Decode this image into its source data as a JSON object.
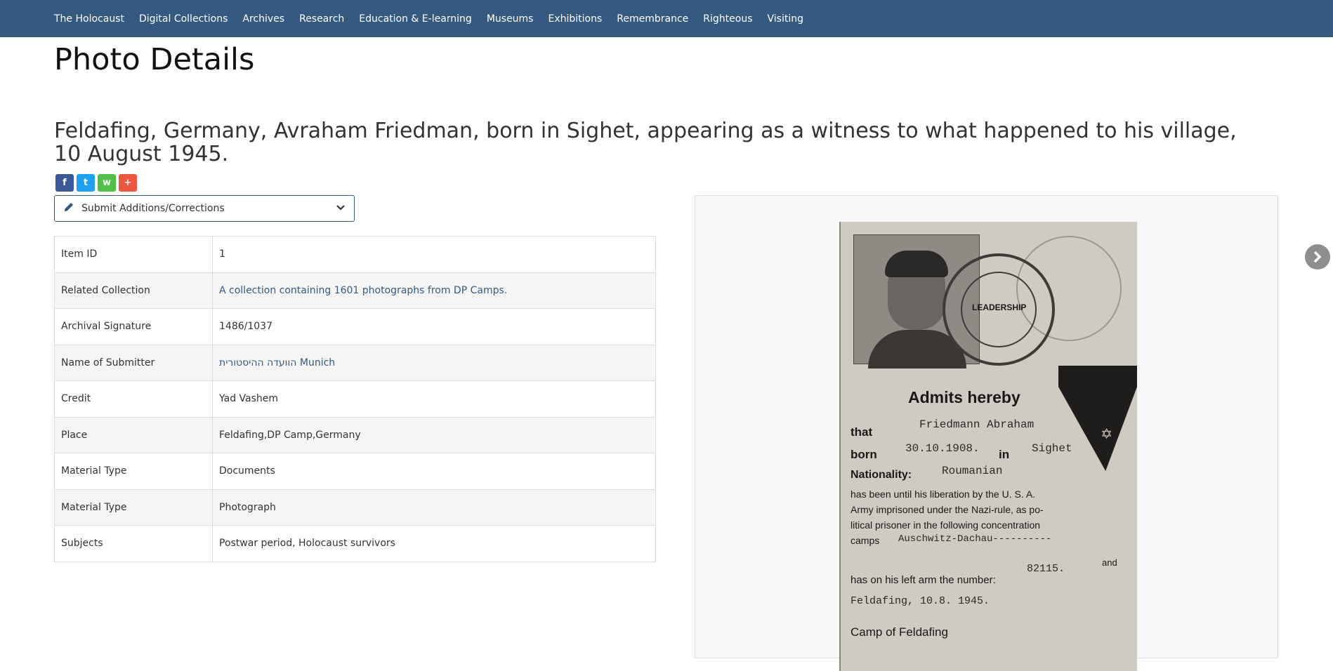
{
  "nav": {
    "items": [
      "The Holocaust",
      "Digital Collections",
      "Archives",
      "Research",
      "Education & E-learning",
      "Museums",
      "Exhibitions",
      "Remembrance",
      "Righteous",
      "Visiting"
    ]
  },
  "page": {
    "title": "Photo Details",
    "photo_title": "Feldafing, Germany, Avraham Friedman, born in Sighet, appearing as a witness to what happened to his village, 10 August 1945."
  },
  "share": {
    "facebook": "f",
    "twitter": "t",
    "whatsapp": "w",
    "more": "+"
  },
  "submit": {
    "label": "Submit Additions/Corrections"
  },
  "details": [
    {
      "key": "Item ID",
      "value": "1"
    },
    {
      "key": "Related Collection",
      "value": "A collection containing 1601 photographs from DP Camps."
    },
    {
      "key": "Archival Signature",
      "value": "1486/1037"
    },
    {
      "key": "Name of Submitter",
      "value": "הוועדה ההיסטורית Munich"
    },
    {
      "key": "Credit",
      "value": "Yad Vashem"
    },
    {
      "key": "Place",
      "value": "Feldafing,DP Camp,Germany"
    },
    {
      "key": "Material Type",
      "value": "Documents"
    },
    {
      "key": "Material Type",
      "value": "Photograph"
    },
    {
      "key": "Subjects",
      "value": "Postwar period, Holocaust survivors"
    }
  ],
  "document": {
    "heading": "Admits hereby",
    "l_that": "that",
    "name": "Friedmann Abraham",
    "l_born": "born",
    "dob": "30.10.1908.",
    "l_in": "in",
    "town": "Sighet",
    "l_nat": "Nationality:",
    "nationality": "Roumanian",
    "line1": "has been until his liberation by the U. S. A.",
    "line2": "Army imprisoned under the Nazi-rule, as po-",
    "line3": "litical prisoner in the following concentration",
    "line4": "camps",
    "camps": "Auschwitz-Dachau----------",
    "number": "82115.",
    "l_and": "and",
    "line5": "has on his left arm the number:",
    "date_place": "Feldafing, 10.8. 1945.",
    "footer": "Camp of Feldafing",
    "stamp_text": "LEADERSHIP"
  },
  "colors": {
    "nav_bg": "#355a81",
    "facebook": "#3b5998",
    "twitter": "#1da1f2",
    "whatsapp": "#4dc247",
    "more": "#f0553f"
  }
}
